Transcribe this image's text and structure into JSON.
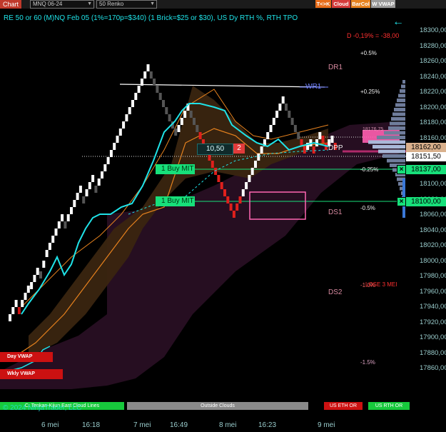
{
  "toolbar": {
    "chart_label": "Chart",
    "instrument": "MNQ 06-24",
    "period": "50 Renko",
    "buttons": [
      {
        "label": "T<>K",
        "color": "#e76d1a"
      },
      {
        "label": "Cloud",
        "color": "#d43a3a"
      },
      {
        "label": "BarCol",
        "color": "#e6821e"
      },
      {
        "label": "W VWAP",
        "color": "#9b9b9b"
      }
    ]
  },
  "status_line": "RE 50 or 60 (M)NQ Feb 05 (1%=170p=$340) (1 Brick=$25 or $30), US Dy RTH %, RTH TPO",
  "daily_change": "D -0,19% = -38,00",
  "percent_labels": [
    "+0.5%",
    "+0.25%",
    "-0.25%",
    "-0.5%",
    "-1.0%",
    "-1.5%"
  ],
  "level_labels": {
    "dr1": "DR1",
    "wr1": "WR1",
    "dpp": "DPP",
    "ds1": "DS1",
    "ds2": "DS2"
  },
  "price_axis": [
    "18300,00",
    "18280,00",
    "18260,00",
    "18240,00",
    "18220,00",
    "18200,00",
    "18180,00",
    "18160,00",
    "18140,00",
    "18120,00",
    "18100,00",
    "18080,00",
    "18060,00",
    "18040,00",
    "18020,00",
    "18000,00",
    "17980,00",
    "17960,00",
    "17940,00",
    "17920,00",
    "17900,00",
    "17880,00",
    "17860,00"
  ],
  "price_badges": [
    {
      "label": "18162,00",
      "color": "#d9b08c"
    },
    {
      "label": "18151,50",
      "color": "#ffffff"
    },
    {
      "label": "18137,00",
      "color": "#17e07a"
    },
    {
      "label": "18100,00",
      "color": "#17e07a"
    }
  ],
  "orders": [
    {
      "label": "1 Buy MIT"
    },
    {
      "label": "1 Buy MIT"
    }
  ],
  "value_box": "10,50",
  "count_box": "2",
  "faint_labels": {
    "pink": "18176,75",
    "red_mid": "LOSE 3 MEI"
  },
  "vwap_tags": {
    "day": "Day VWAP",
    "weekly": "Wkly VWAP"
  },
  "bottom_bar": {
    "tenkan_kijun": "C: Tenkan-Kijun East Cloud Lines",
    "outside": "Outside Clouds",
    "us_eth": "US ETH OR",
    "us_rth": "US RTH OR"
  },
  "copyright": "© 2024 NinjaTrader, LLC",
  "time_axis": [
    "6 mei",
    "16:18",
    "7 mei",
    "16:49",
    "8 mei",
    "16:23",
    "9 mei"
  ],
  "colors": {
    "cyan": "#1fe3e8",
    "green": "#17e07a",
    "red": "#e0201c",
    "orange": "#e6821e",
    "pink": "#ff66b3"
  }
}
